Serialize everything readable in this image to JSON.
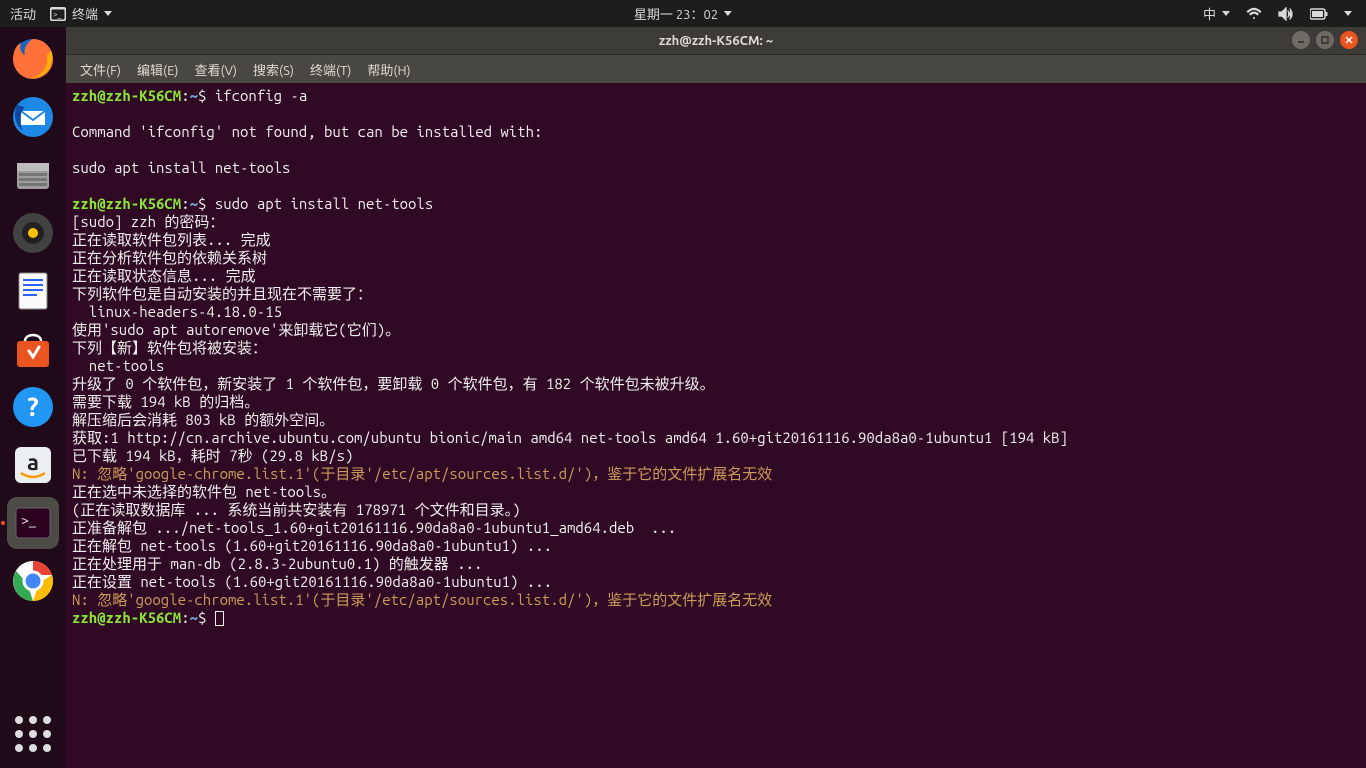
{
  "topbar": {
    "activities": "活动",
    "app_indicator": "终端",
    "clock": "星期一 23：02",
    "ime": "中"
  },
  "window": {
    "title": "zzh@zzh-K56CM: ~"
  },
  "menubar": {
    "file": "文件(F)",
    "edit": "编辑(E)",
    "view": "查看(V)",
    "search": "搜索(S)",
    "terminal": "终端(T)",
    "help": "帮助(H)"
  },
  "prompt": {
    "userhost": "zzh@zzh-K56CM",
    "path": "~",
    "sep": ":",
    "sym": "$"
  },
  "term": {
    "cmd1": "ifconfig -a",
    "l_blank": "",
    "l_nf": "Command 'ifconfig' not found, but can be installed with:",
    "l_sugg": "sudo apt install net-tools",
    "cmd2": "sudo apt install net-tools",
    "l_sudo": "[sudo] zzh 的密码：",
    "l_read": "正在读取软件包列表... 完成",
    "l_dep": "正在分析软件包的依赖关系树",
    "l_state": "正在读取状态信息... 完成",
    "l_auto": "下列软件包是自动安装的并且现在不需要了：",
    "l_hdr": "  linux-headers-4.18.0-15",
    "l_autorm": "使用'sudo apt autoremove'来卸载它(它们)。",
    "l_new": "下列【新】软件包将被安装：",
    "l_nt": "  net-tools",
    "l_sum": "升级了 0 个软件包，新安装了 1 个软件包，要卸载 0 个软件包，有 182 个软件包未被升级。",
    "l_dl": "需要下载 194 kB 的归档。",
    "l_unz": "解压缩后会消耗 803 kB 的额外空间。",
    "l_get": "获取:1 http://cn.archive.ubuntu.com/ubuntu bionic/main amd64 net-tools amd64 1.60+git20161116.90da8a0-1ubuntu1 [194 kB]",
    "l_done": "已下载 194 kB，耗时 7秒 (29.8 kB/s)",
    "l_n1": "N: 忽略'google-chrome.list.1'(于目录'/etc/apt/sources.list.d/')，鉴于它的文件扩展名无效",
    "l_sel": "正在选中未选择的软件包 net-tools。",
    "l_db": "(正在读取数据库 ... 系统当前共安装有 178971 个文件和目录。)",
    "l_prep": "正准备解包 .../net-tools_1.60+git20161116.90da8a0-1ubuntu1_amd64.deb  ...",
    "l_unpack": "正在解包 net-tools (1.60+git20161116.90da8a0-1ubuntu1) ...",
    "l_trig": "正在处理用于 man-db (2.8.3-2ubuntu0.1) 的触发器 ...",
    "l_set": "正在设置 net-tools (1.60+git20161116.90da8a0-1ubuntu1) ...",
    "l_n2": "N: 忽略'google-chrome.list.1'(于目录'/etc/apt/sources.list.d/')，鉴于它的文件扩展名无效"
  }
}
